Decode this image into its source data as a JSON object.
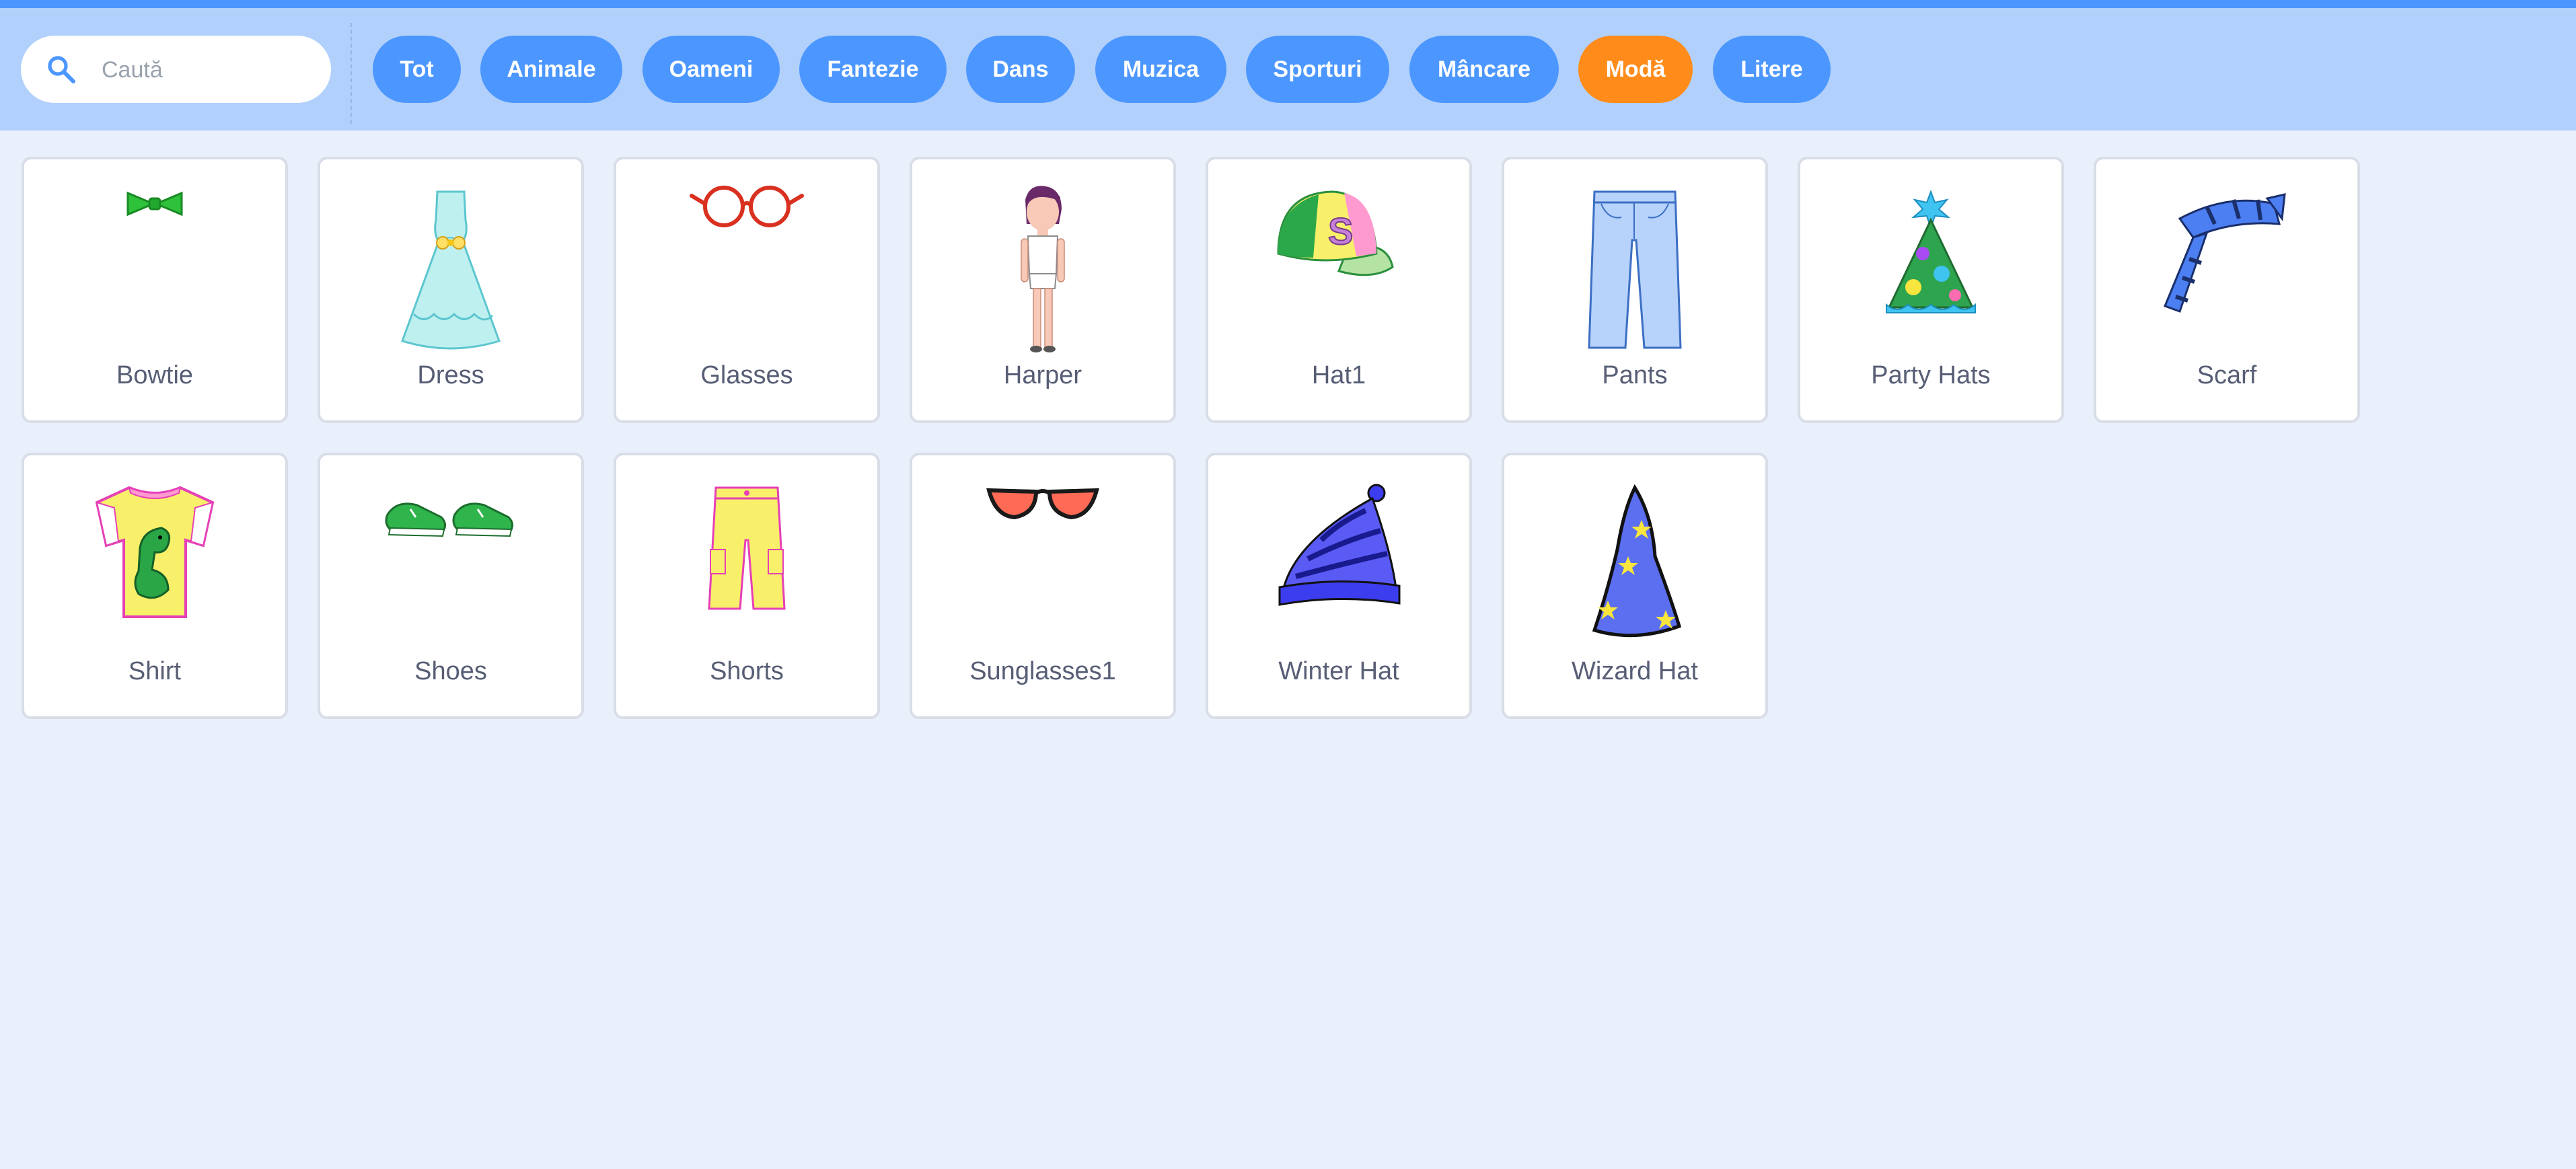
{
  "search": {
    "placeholder": "Caută",
    "icon": "search-icon"
  },
  "tags": [
    {
      "label": "Tot"
    },
    {
      "label": "Animale"
    },
    {
      "label": "Oameni"
    },
    {
      "label": "Fantezie"
    },
    {
      "label": "Dans"
    },
    {
      "label": "Muzica"
    },
    {
      "label": "Sporturi"
    },
    {
      "label": "Mâncare"
    },
    {
      "label": "Modă",
      "selected": true
    },
    {
      "label": "Litere"
    }
  ],
  "items": [
    {
      "label": "Bowtie",
      "icon": "bowtie-icon"
    },
    {
      "label": "Dress",
      "icon": "dress-icon"
    },
    {
      "label": "Glasses",
      "icon": "glasses-icon"
    },
    {
      "label": "Harper",
      "icon": "harper-icon"
    },
    {
      "label": "Hat1",
      "icon": "cap-icon"
    },
    {
      "label": "Pants",
      "icon": "pants-icon"
    },
    {
      "label": "Party Hats",
      "icon": "party-hat-icon"
    },
    {
      "label": "Scarf",
      "icon": "scarf-icon"
    },
    {
      "label": "Shirt",
      "icon": "shirt-icon"
    },
    {
      "label": "Shoes",
      "icon": "shoes-icon"
    },
    {
      "label": "Shorts",
      "icon": "shorts-icon"
    },
    {
      "label": "Sunglasses1",
      "icon": "sunglasses-icon"
    },
    {
      "label": "Winter Hat",
      "icon": "winter-hat-icon"
    },
    {
      "label": "Wizard Hat",
      "icon": "wizard-hat-icon"
    }
  ],
  "colors": {
    "accent": "#4c97ff",
    "selected": "#ff8c1a",
    "header": "#b2d0fc",
    "background": "#e9f0fc",
    "text": "#575e75"
  }
}
